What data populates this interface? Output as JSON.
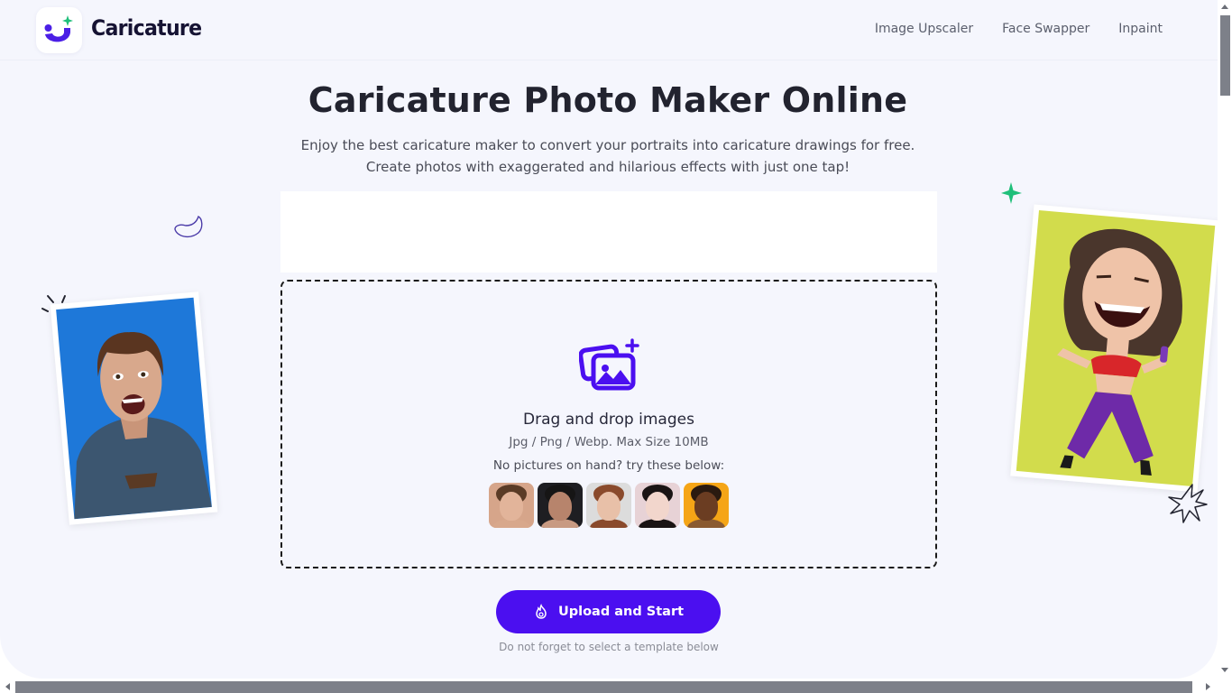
{
  "header": {
    "brand": "Caricature",
    "logo_icon": "smile-sparkle-logo-icon",
    "nav": [
      {
        "label": "Image Upscaler"
      },
      {
        "label": "Face Swapper"
      },
      {
        "label": "Inpaint"
      }
    ]
  },
  "hero": {
    "title": "Caricature Photo Maker Online",
    "subtitle_line1": "Enjoy the best caricature maker to convert your portraits into caricature drawings for free.",
    "subtitle_line2": "Create photos with exaggerated and hilarious effects with just one tap!"
  },
  "dropzone": {
    "icon": "add-images-icon",
    "title": "Drag and drop images",
    "formats": "Jpg / Png / Webp. Max Size 10MB",
    "try_text": "No pictures on hand? try these below:",
    "samples": [
      {
        "name": "sample-man-light",
        "bg": "#d6a58a",
        "skin": "#e2b49a",
        "hair": "#5a3b26",
        "clothes": "#d8a88c"
      },
      {
        "name": "sample-man-dark",
        "bg": "#1e1e22",
        "skin": "#b7846c",
        "hair": "#161515",
        "clothes": "#c89a82"
      },
      {
        "name": "sample-woman-redhead",
        "bg": "#dcdcdc",
        "skin": "#e8c0a8",
        "hair": "#8a4a2c",
        "clothes": "#8a4a2c"
      },
      {
        "name": "sample-woman-asian",
        "bg": "#e7d2d6",
        "skin": "#f2d6cc",
        "hair": "#1a1414",
        "clothes": "#1a1414"
      },
      {
        "name": "sample-woman-curly",
        "bg": "#f5a516",
        "skin": "#6b3d22",
        "hair": "#2a1a10",
        "clothes": "#8a5a30"
      }
    ]
  },
  "cta": {
    "upload_label": "Upload and Start",
    "upload_icon": "flame-icon",
    "note": "Do not forget to select a template below"
  },
  "colors": {
    "accent": "#4b0ff0",
    "background": "#f5f6fd",
    "text_dark": "#22232f",
    "sparkle_green": "#1fbf7a"
  }
}
